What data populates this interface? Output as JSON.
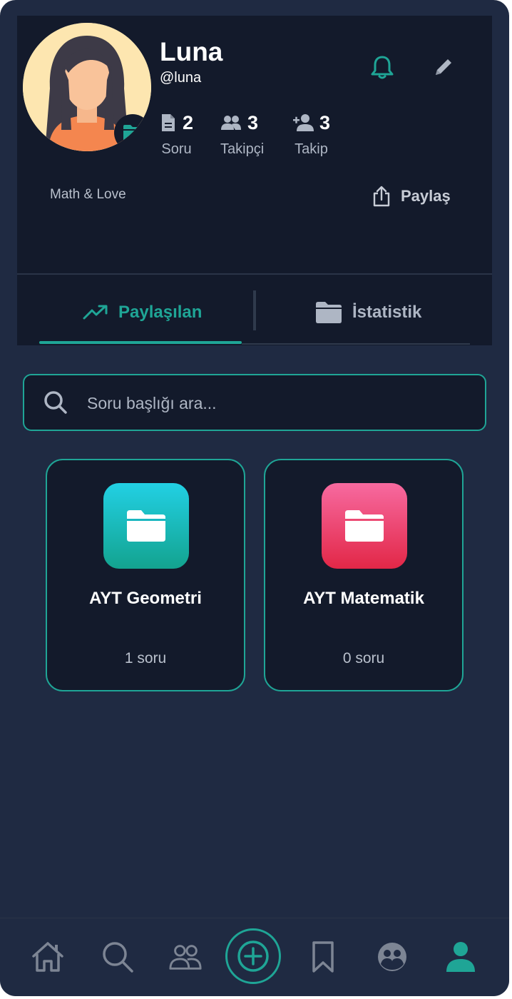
{
  "profile": {
    "name": "Luna",
    "handle": "@luna",
    "bio": "Math & Love"
  },
  "stats": [
    {
      "icon": "document-icon",
      "value": "2",
      "label": "Soru"
    },
    {
      "icon": "group-icon",
      "value": "3",
      "label": "Takipçi"
    },
    {
      "icon": "person-add-icon",
      "value": "3",
      "label": "Takip"
    }
  ],
  "actions": {
    "notification_icon": "bell-icon",
    "edit_icon": "pencil-icon",
    "share_label": "Paylaş"
  },
  "tabs": [
    {
      "label": "Paylaşılan",
      "icon": "trending-up-icon",
      "active": true
    },
    {
      "label": "İstatistik",
      "icon": "folder-icon",
      "active": false
    }
  ],
  "search": {
    "placeholder": "Soru başlığı ara..."
  },
  "folders": [
    {
      "title": "AYT Geometri",
      "count": "1 soru",
      "color": "#19b3b3"
    },
    {
      "title": "AYT Matematik",
      "count": "0 soru",
      "color": "#e8315f"
    }
  ],
  "bottom_nav": [
    "home-icon",
    "search-icon",
    "people-icon",
    "add-icon",
    "bookmark-icon",
    "community-icon",
    "profile-icon"
  ],
  "colors": {
    "accent": "#1fa596",
    "background": "#1f2a42",
    "card": "#131a2b"
  }
}
